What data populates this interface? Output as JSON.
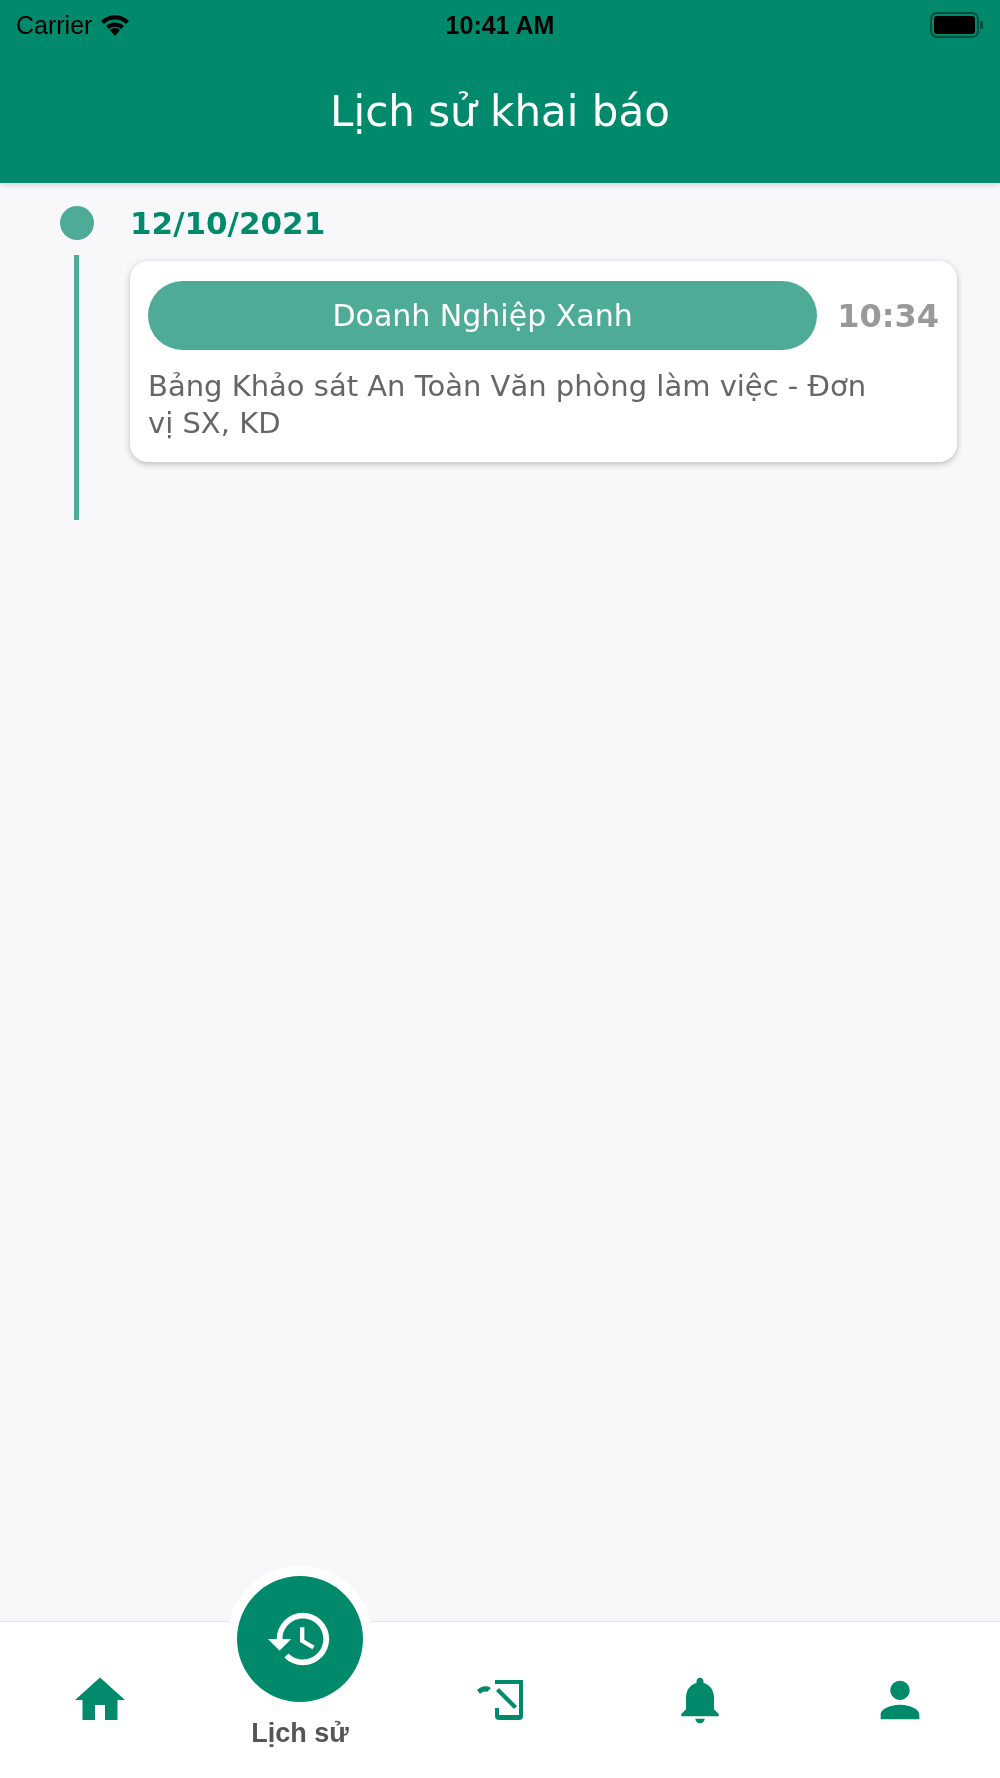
{
  "status_bar": {
    "carrier": "Carrier",
    "time": "10:41 AM"
  },
  "header": {
    "title": "Lịch sử khai báo"
  },
  "timeline": [
    {
      "date": "12/10/2021",
      "entries": [
        {
          "tag": "Doanh Nghiệp Xanh",
          "time": "10:34",
          "description": "Bảng Khảo sát An Toàn Văn phòng làm việc - Đơn vị SX, KD"
        }
      ]
    }
  ],
  "tabs": [
    {
      "kind": "home",
      "selected": false
    },
    {
      "kind": "history",
      "selected": true,
      "label": "Lịch sử"
    },
    {
      "kind": "document",
      "selected": false
    },
    {
      "kind": "bell",
      "selected": false
    },
    {
      "kind": "person",
      "selected": false
    }
  ]
}
